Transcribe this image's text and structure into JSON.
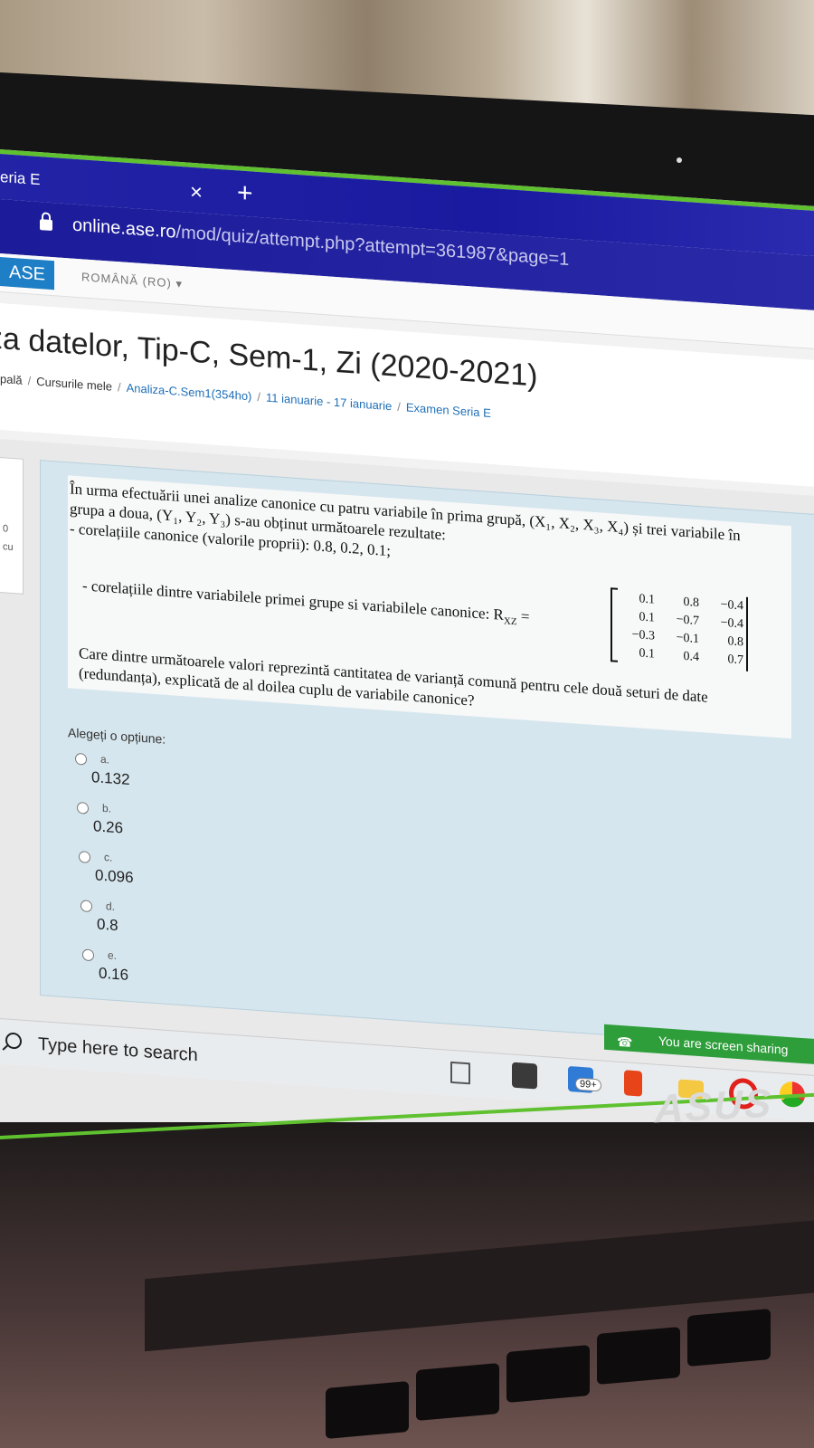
{
  "browser": {
    "tab_title": "eria E",
    "tab_close": "×",
    "new_tab": "+",
    "url_main": "online.ase.ro",
    "url_path": "/mod/quiz/attempt.php?attempt=361987&page=1"
  },
  "topnav": {
    "logo": "ASE",
    "language": "ROMÂNĂ (RO) ▾"
  },
  "page": {
    "course_title": "za datelor, Tip-C, Sem-1, Zi (2020-2021)",
    "breadcrumb": [
      "pală",
      "Cursurile mele",
      "Analiza-C.Sem1(354ho)",
      "11 ianuarie - 17 ianuarie",
      "Examen Seria E"
    ],
    "side_card": [
      "0",
      "cu"
    ]
  },
  "question": {
    "text_line1": "În urma efectuării unei analize canonice cu patru variabile în prima grupă, (X₁, X₂, X₃, X₄) și trei variabile în grupa a doua, (Y₁, Y₂, Y₃) s-au obținut următoarele rezultate:",
    "text_line2": "- corelațiile canonice (valorile proprii): 0.8, 0.2, 0.1;",
    "matrix_label": "- corelațiile dintre  variabilele primei grupe si variabilele canonice: R",
    "matrix_subscript": "XZ",
    "matrix_equals": " =",
    "matrix": [
      [
        "0.1",
        "0.8",
        "−0.4"
      ],
      [
        "0.1",
        "−0.7",
        "−0.4"
      ],
      [
        "−0.3",
        "−0.1",
        "0.8"
      ],
      [
        "0.1",
        "0.4",
        "0.7"
      ]
    ],
    "prompt": "Care dintre următoarele valori reprezintă cantitatea de varianță comună pentru cele două seturi de date (redundanța), explicată de al doilea cuplu de variabile canonice?",
    "answers_label": "Alegeți o opțiune:",
    "options": [
      {
        "letter": "a.",
        "value": "0.132"
      },
      {
        "letter": "b.",
        "value": "0.26"
      },
      {
        "letter": "c.",
        "value": "0.096"
      },
      {
        "letter": "d.",
        "value": "0.8"
      },
      {
        "letter": "e.",
        "value": "0.16"
      }
    ]
  },
  "notification": {
    "sharing_text": "You are screen sharing"
  },
  "taskbar": {
    "search_placeholder": "Type here to search",
    "mail_badge": "99+"
  },
  "laptop": {
    "brand": "ASUS"
  }
}
